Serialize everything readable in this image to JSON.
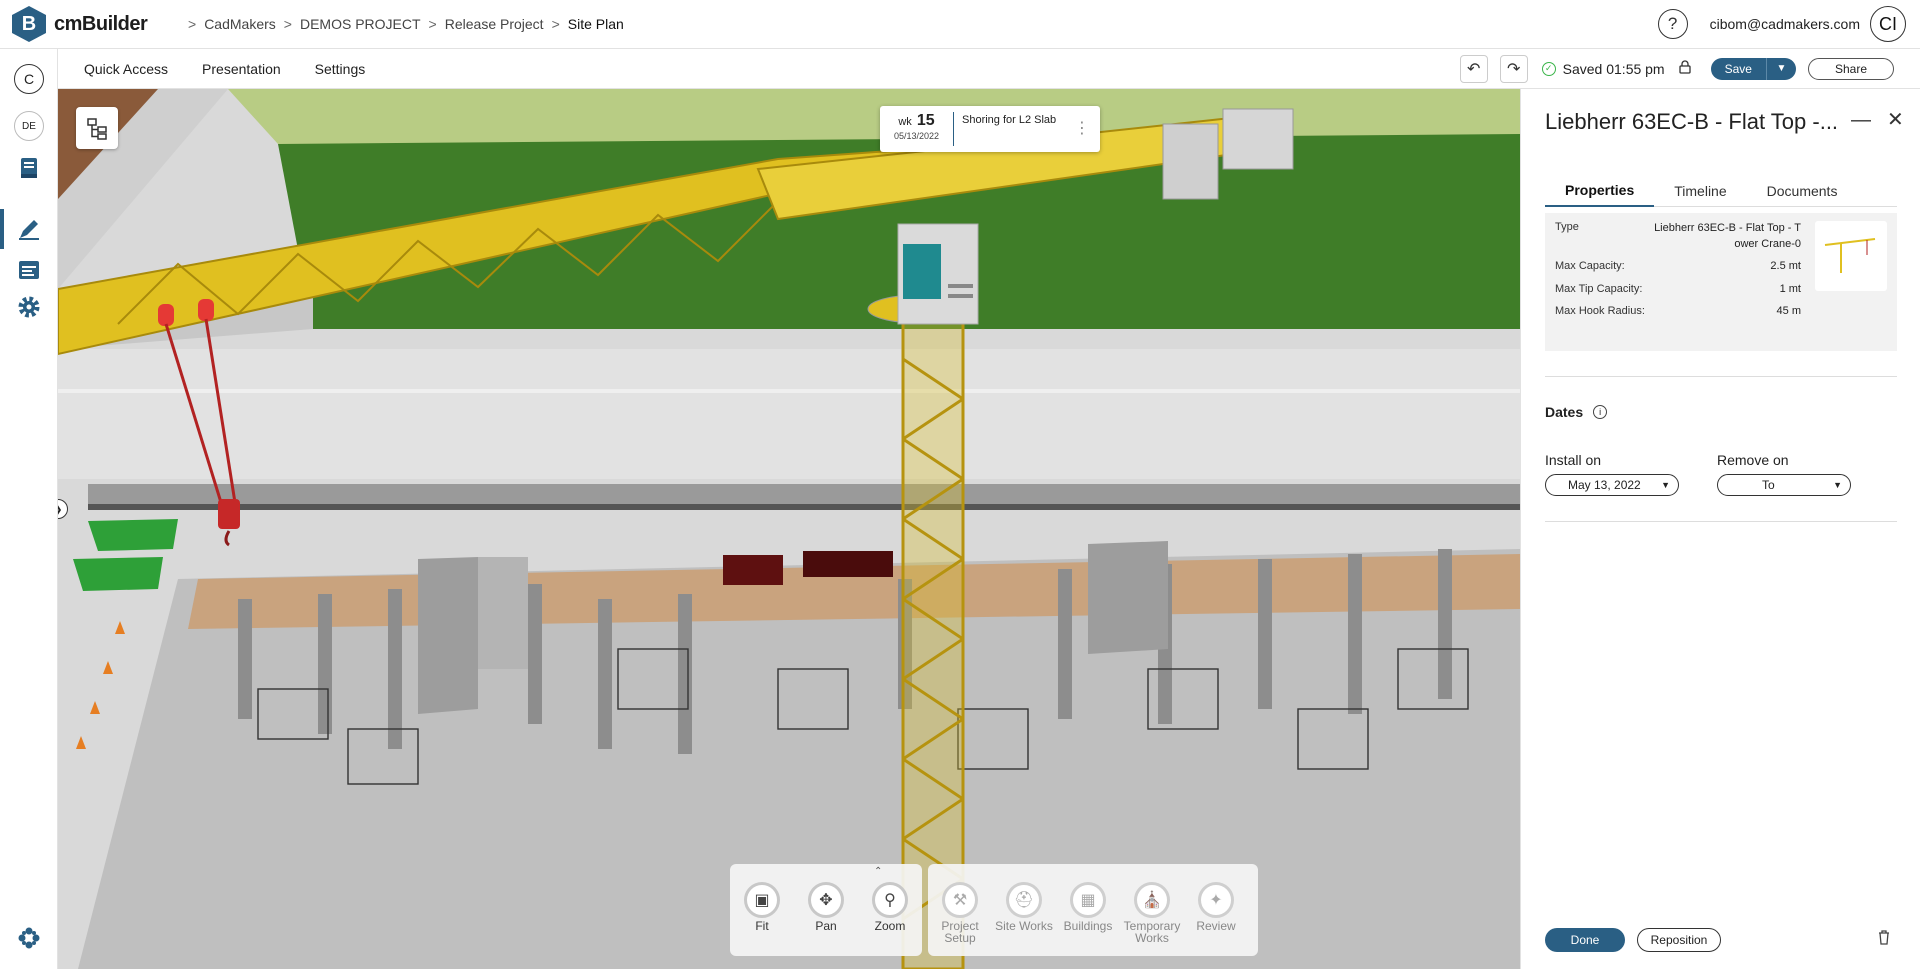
{
  "app": {
    "logo_letter": "B",
    "name": "cmBuilder"
  },
  "breadcrumb": [
    "CadMakers",
    "DEMOS PROJECT",
    "Release Project",
    "Site Plan"
  ],
  "user": {
    "help": "?",
    "email": "cibom@cadmakers.com",
    "initials": "CI"
  },
  "leftrail": {
    "top_badge": "C",
    "lang": "DE",
    "icons": [
      "book-icon",
      "pen-icon",
      "schedule-icon",
      "gear-icon"
    ],
    "bottom_icon": "apps-icon"
  },
  "menu": {
    "quick_access": "Quick Access",
    "presentation": "Presentation",
    "settings": "Settings"
  },
  "status": {
    "saved": "Saved 01:55 pm",
    "save": "Save",
    "share": "Share"
  },
  "week": {
    "prefix": "wk",
    "number": "15",
    "date": "05/13/2022",
    "activity": "Shoring for L2 Slab"
  },
  "toolbar": {
    "nav": [
      {
        "label": "Fit",
        "icon": "fit-icon"
      },
      {
        "label": "Pan",
        "icon": "pan-icon"
      },
      {
        "label": "Zoom",
        "icon": "zoom-icon"
      }
    ],
    "categories": [
      {
        "label": "Project Setup",
        "icon": "tools-icon"
      },
      {
        "label": "Site Works",
        "icon": "excavator-icon"
      },
      {
        "label": "Buildings",
        "icon": "building-icon"
      },
      {
        "label": "Temporary Works",
        "icon": "crane-icon"
      },
      {
        "label": "Review",
        "icon": "review-icon"
      }
    ]
  },
  "panel": {
    "title": "Liebherr 63EC-B - Flat Top -...",
    "tabs": [
      "Properties",
      "Timeline",
      "Documents"
    ],
    "properties": {
      "type_label": "Type",
      "type_value_1": "Liebherr 63EC-B - Flat Top - T",
      "type_value_2": "ower Crane-0",
      "max_capacity_label": "Max Capacity:",
      "max_capacity": "2.5 mt",
      "max_tip_label": "Max Tip Capacity:",
      "max_tip": "1 mt",
      "max_hook_label": "Max Hook Radius:",
      "max_hook": "45 m"
    },
    "dates": {
      "heading": "Dates",
      "install_label": "Install on",
      "install_value": "May 13, 2022",
      "remove_label": "Remove on",
      "remove_value": "To"
    },
    "done": "Done",
    "reposition": "Reposition"
  },
  "colors": {
    "accent": "#2a5f84",
    "crane": "#e0c020",
    "grass": "#3f7d28",
    "hook": "#b22222",
    "container": "#2ea038"
  }
}
